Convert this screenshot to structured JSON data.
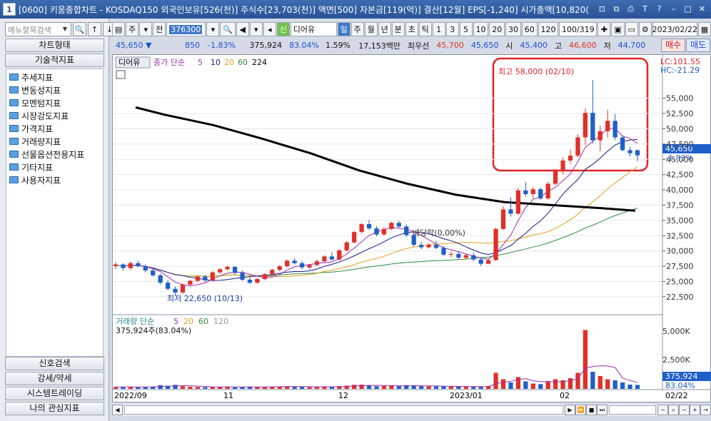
{
  "window": {
    "title": "[0600] 키움종합차트 - KOSDAQ150 외국인보유[526(천)] 주식수[23,703(천)] 액면[500] 자본금[119(억)] 결산[12월] EPS[-1,240] 시가총액[10,820(",
    "number": "1"
  },
  "left": {
    "search_placeholder": "메뉴항목검색",
    "chart_type_btn": "차트형태",
    "tech_btn": "기술적지표",
    "tree": [
      "추세지표",
      "변동성지표",
      "모멘텀지표",
      "시장강도지표",
      "가격지표",
      "거래량지표",
      "선물옵션전용지표",
      "기타지표",
      "사용자지표"
    ],
    "bottom_buttons": [
      "신호검색",
      "강세/약세",
      "시스템트레이딩",
      "나의 관심지표"
    ]
  },
  "toolbar": {
    "mode": "주",
    "prev": "전",
    "code": "376300",
    "new_badge": "신",
    "name": "디어유",
    "periods": [
      "일",
      "주",
      "월",
      "년",
      "분",
      "초",
      "틱"
    ],
    "nums": [
      "1",
      "3",
      "5",
      "10",
      "20",
      "30",
      "60",
      "120"
    ],
    "count": "100/319",
    "date": "2023/02/22"
  },
  "info": {
    "price": "45,650",
    "change": "850",
    "pct": "-1.83%",
    "volume": "375,924",
    "vol_ratio": "83.04%",
    "turnover": "1.59%",
    "amount": "17,153백만",
    "best_label": "최우선",
    "ask": "45,700",
    "bid": "45,650",
    "open_label": "시",
    "open": "45,400",
    "high_label": "고",
    "high": "46,600",
    "low_label": "저",
    "low": "44,700",
    "buy": "매수",
    "sell": "매도"
  },
  "chart": {
    "name_tag": "디어유",
    "legend_head": "종가 단순",
    "ma_periods": [
      "5",
      "10",
      "20",
      "60",
      "224"
    ],
    "lc": "LC:101.55",
    "hc": "HC:-21.29",
    "high_annotation": "최고 58,000 (02/10)",
    "low_annotation": "최저 22,650 (10/13)",
    "dividend": "배당락(0,00%)",
    "current_price": "45,650",
    "current_pct": "-1.83%",
    "volume_legend_head": "거래량 단순",
    "vol_ma_periods": [
      "5",
      "20",
      "60",
      "120"
    ],
    "volume_text": "375,924주(83.04%)",
    "vol_current": "375,924",
    "vol_pct": "83.04%",
    "price_ticks": [
      "55,000",
      "52,500",
      "50,000",
      "47,500",
      "45,000",
      "42,500",
      "40,000",
      "37,500",
      "35,000",
      "32,500",
      "30,000",
      "27,500",
      "25,000",
      "22,500"
    ],
    "vol_ticks": [
      "5,000K",
      "2,500K"
    ],
    "date_labels": [
      "2022/09",
      "11",
      "12",
      "2023/01",
      "02",
      "02/22"
    ],
    "colors": {
      "up": "#e0302a",
      "down": "#1f5fc8",
      "ma5": "#9b2fb0",
      "ma10": "#1a1a8c",
      "ma20": "#e0a21e",
      "ma60": "#2e8b3e",
      "ma224": "#000000"
    }
  },
  "chart_data": {
    "type": "candlestick",
    "y_range": [
      20500,
      58000
    ],
    "candles": [
      [
        27500,
        28200,
        27000,
        27800
      ],
      [
        27800,
        28000,
        26800,
        27200
      ],
      [
        27200,
        28300,
        26900,
        28000
      ],
      [
        28000,
        28400,
        27300,
        27500
      ],
      [
        27500,
        27800,
        26500,
        26800
      ],
      [
        26800,
        27100,
        25800,
        26000
      ],
      [
        26000,
        26300,
        24500,
        24800
      ],
      [
        24800,
        25200,
        23500,
        23800
      ],
      [
        23800,
        24200,
        22650,
        23200
      ],
      [
        23200,
        24700,
        23000,
        24500
      ],
      [
        24500,
        25300,
        24200,
        25100
      ],
      [
        25100,
        26000,
        24900,
        25800
      ],
      [
        25800,
        26100,
        24900,
        25200
      ],
      [
        25200,
        26700,
        25000,
        26500
      ],
      [
        26500,
        27200,
        26300,
        27000
      ],
      [
        27000,
        27600,
        26800,
        27400
      ],
      [
        27400,
        27500,
        26200,
        26400
      ],
      [
        26400,
        26800,
        25100,
        25300
      ],
      [
        25300,
        25700,
        24500,
        24800
      ],
      [
        24800,
        25600,
        24600,
        25400
      ],
      [
        25400,
        26400,
        25200,
        26200
      ],
      [
        26200,
        27100,
        26000,
        26900
      ],
      [
        26900,
        27700,
        26700,
        27500
      ],
      [
        27500,
        28600,
        27300,
        28400
      ],
      [
        28400,
        28800,
        27800,
        28000
      ],
      [
        28000,
        28300,
        27000,
        27300
      ],
      [
        27300,
        27900,
        27000,
        27700
      ],
      [
        27700,
        28600,
        27500,
        28300
      ],
      [
        28300,
        29300,
        28100,
        29100
      ],
      [
        29100,
        29800,
        28400,
        28600
      ],
      [
        28600,
        30300,
        28400,
        30100
      ],
      [
        30100,
        31600,
        29900,
        31400
      ],
      [
        31400,
        33300,
        31200,
        33100
      ],
      [
        33100,
        34600,
        32900,
        34400
      ],
      [
        34400,
        35100,
        33400,
        33700
      ],
      [
        33700,
        34100,
        32400,
        32700
      ],
      [
        32700,
        33900,
        32500,
        33600
      ],
      [
        33600,
        34800,
        33400,
        34600
      ],
      [
        34600,
        34900,
        33800,
        34000
      ],
      [
        34000,
        34300,
        32300,
        32600
      ],
      [
        32600,
        32900,
        30700,
        31000
      ],
      [
        31000,
        31500,
        30300,
        30600
      ],
      [
        30600,
        31300,
        30400,
        31000
      ],
      [
        31000,
        31600,
        30300,
        30500
      ],
      [
        30500,
        30800,
        29200,
        29400
      ],
      [
        29400,
        29900,
        28900,
        29500
      ],
      [
        29500,
        30000,
        28700,
        28900
      ],
      [
        28900,
        29600,
        28600,
        29300
      ],
      [
        29300,
        29700,
        28300,
        28600
      ],
      [
        28600,
        29000,
        27500,
        27900
      ],
      [
        27900,
        28700,
        27800,
        28500
      ],
      [
        28500,
        33800,
        28400,
        33600
      ],
      [
        33600,
        37300,
        33400,
        36800
      ],
      [
        36800,
        38800,
        35600,
        36100
      ],
      [
        36100,
        40300,
        35900,
        39900
      ],
      [
        39900,
        41300,
        38900,
        39300
      ],
      [
        39300,
        40500,
        38600,
        40100
      ],
      [
        40100,
        40400,
        38300,
        38600
      ],
      [
        38600,
        41300,
        38400,
        41000
      ],
      [
        41000,
        43400,
        40800,
        43100
      ],
      [
        43100,
        45300,
        42600,
        44800
      ],
      [
        44800,
        46600,
        44300,
        45600
      ],
      [
        45600,
        49100,
        45300,
        48600
      ],
      [
        48600,
        53300,
        47300,
        52600
      ],
      [
        52600,
        58000,
        47600,
        48100
      ],
      [
        48100,
        50500,
        46300,
        49600
      ],
      [
        49600,
        53100,
        48600,
        51300
      ],
      [
        51300,
        52400,
        48100,
        48600
      ],
      [
        48600,
        48900,
        46300,
        46500
      ],
      [
        46500,
        47000,
        45500,
        46000
      ],
      [
        46500,
        46600,
        44700,
        45650
      ]
    ],
    "volume_k": [
      180,
      160,
      200,
      150,
      170,
      220,
      350,
      300,
      380,
      250,
      200,
      180,
      160,
      170,
      190,
      210,
      150,
      160,
      180,
      170,
      200,
      210,
      230,
      250,
      200,
      180,
      160,
      190,
      220,
      200,
      260,
      300,
      380,
      400,
      300,
      250,
      280,
      320,
      260,
      350,
      300,
      250,
      240,
      230,
      260,
      220,
      210,
      200,
      190,
      230,
      260,
      1500,
      900,
      600,
      1100,
      700,
      500,
      450,
      700,
      900,
      800,
      1000,
      1500,
      5500,
      1600,
      1200,
      900,
      800,
      600,
      400,
      375.924
    ]
  }
}
